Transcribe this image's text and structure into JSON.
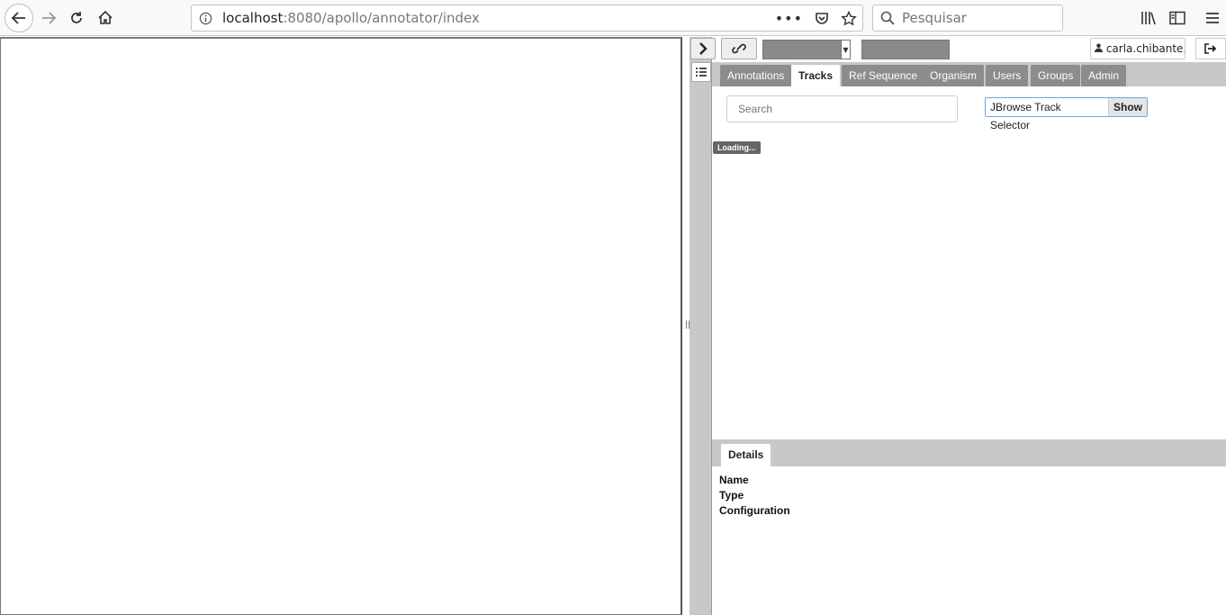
{
  "browser": {
    "url_host": "localhost",
    "url_path": ":8080/apollo/annotator/index",
    "search_placeholder": "Pesquisar"
  },
  "topbar": {
    "user_label": "carla.chibante...",
    "organism_value": "",
    "sequence_value": ""
  },
  "tabs": [
    {
      "label": "Annotations",
      "active": false
    },
    {
      "label": "Tracks",
      "active": true
    },
    {
      "label": "Ref Sequence",
      "active": false
    },
    {
      "label": "Organism",
      "active": false
    },
    {
      "label": "Users",
      "active": false
    },
    {
      "label": "Groups",
      "active": false
    },
    {
      "label": "Admin",
      "active": false
    }
  ],
  "tracks": {
    "search_placeholder": "Search",
    "selector_label": "JBrowse Track Selector",
    "show_label": "Show",
    "loading_label": "Loading..."
  },
  "details": {
    "tab_label": "Details",
    "fields": [
      "Name",
      "Type",
      "Configuration"
    ]
  }
}
